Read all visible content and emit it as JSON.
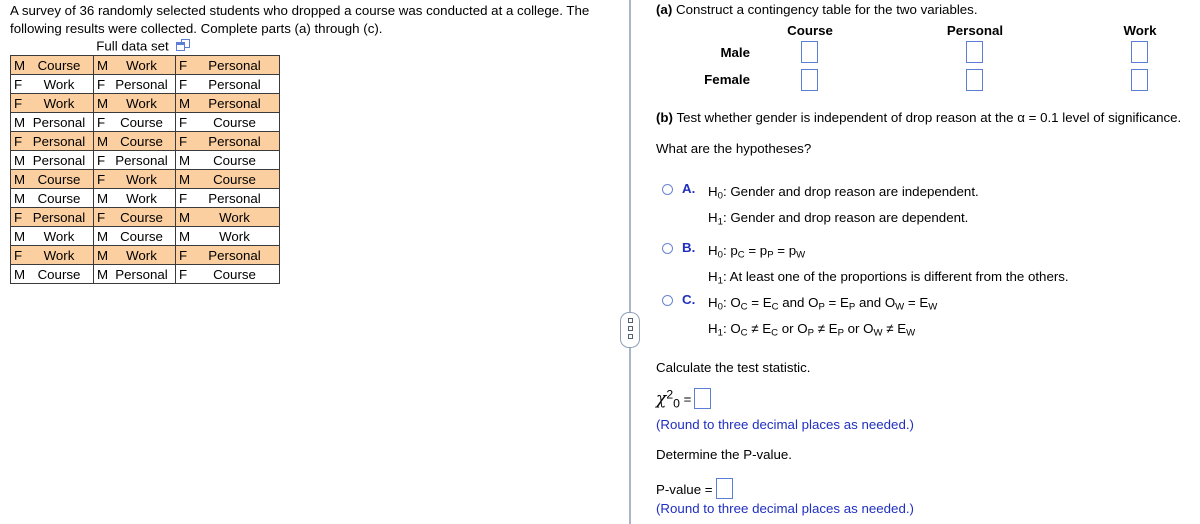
{
  "left": {
    "intro": "A survey of 36 randomly selected students who dropped a course was conducted at a college. The following results were collected. Complete parts (a) through (c).",
    "full_data_set_label": "Full data set",
    "popout_icon": "popout-window-icon",
    "highlight_color": "#fbcfa0",
    "table_rows": [
      [
        [
          "M",
          "Course"
        ],
        [
          "M",
          "Work"
        ],
        [
          "F",
          "Personal"
        ]
      ],
      [
        [
          "F",
          "Work"
        ],
        [
          "F",
          "Personal"
        ],
        [
          "F",
          "Personal"
        ]
      ],
      [
        [
          "F",
          "Work"
        ],
        [
          "M",
          "Work"
        ],
        [
          "M",
          "Personal"
        ]
      ],
      [
        [
          "M",
          "Personal"
        ],
        [
          "F",
          "Course"
        ],
        [
          "F",
          "Course"
        ]
      ],
      [
        [
          "F",
          "Personal"
        ],
        [
          "M",
          "Course"
        ],
        [
          "F",
          "Personal"
        ]
      ],
      [
        [
          "M",
          "Personal"
        ],
        [
          "F",
          "Personal"
        ],
        [
          "M",
          "Course"
        ]
      ],
      [
        [
          "M",
          "Course"
        ],
        [
          "F",
          "Work"
        ],
        [
          "M",
          "Course"
        ]
      ],
      [
        [
          "M",
          "Course"
        ],
        [
          "M",
          "Work"
        ],
        [
          "F",
          "Personal"
        ]
      ],
      [
        [
          "F",
          "Personal"
        ],
        [
          "F",
          "Course"
        ],
        [
          "M",
          "Work"
        ]
      ],
      [
        [
          "M",
          "Work"
        ],
        [
          "M",
          "Course"
        ],
        [
          "M",
          "Work"
        ]
      ],
      [
        [
          "F",
          "Work"
        ],
        [
          "M",
          "Work"
        ],
        [
          "F",
          "Personal"
        ]
      ],
      [
        [
          "M",
          "Course"
        ],
        [
          "M",
          "Personal"
        ],
        [
          "F",
          "Course"
        ]
      ]
    ]
  },
  "right": {
    "part_a_prefix": "(a)",
    "part_a_text": "Construct a contingency table for the two variables.",
    "ct_columns": [
      "Course",
      "Personal",
      "Work"
    ],
    "ct_rows": [
      "Male",
      "Female"
    ],
    "part_b_prefix": "(b)",
    "part_b_text": "Test whether gender is independent of drop reason at the α = 0.1 level of significance.",
    "hypotheses_prompt": "What are the hypotheses?",
    "choices": [
      {
        "letter": "A.",
        "line1_pre": "H",
        "line1_sub": "0",
        "line1_post": ": Gender and drop reason are independent.",
        "line2_pre": "H",
        "line2_sub": "1",
        "line2_post": ": Gender and drop reason are dependent."
      },
      {
        "letter": "B.",
        "line1": "H₀: p_C = p_P = p_W",
        "line2": "H₁: At least one of the proportions is different from the others."
      },
      {
        "letter": "C.",
        "line1": "H₀: O_C = E_C and O_P = E_P and O_W = E_W",
        "line2": "H₁: O_C ≠ E_C or O_P ≠ E_P or O_W ≠ E_W"
      }
    ],
    "calc_stat_prompt": "Calculate the test statistic.",
    "chi_symbol": "χ",
    "chi_sup": "2",
    "chi_sub": "0",
    "chi_equals": "=",
    "round_note_1": "(Round to three decimal places as needed.)",
    "pvalue_prompt": "Determine the P-value.",
    "pvalue_label": "P-value =",
    "round_note_2": "(Round to three decimal places as needed.)",
    "accent_blue": "#1f2fbf",
    "box_border": "#5b7fd4"
  }
}
